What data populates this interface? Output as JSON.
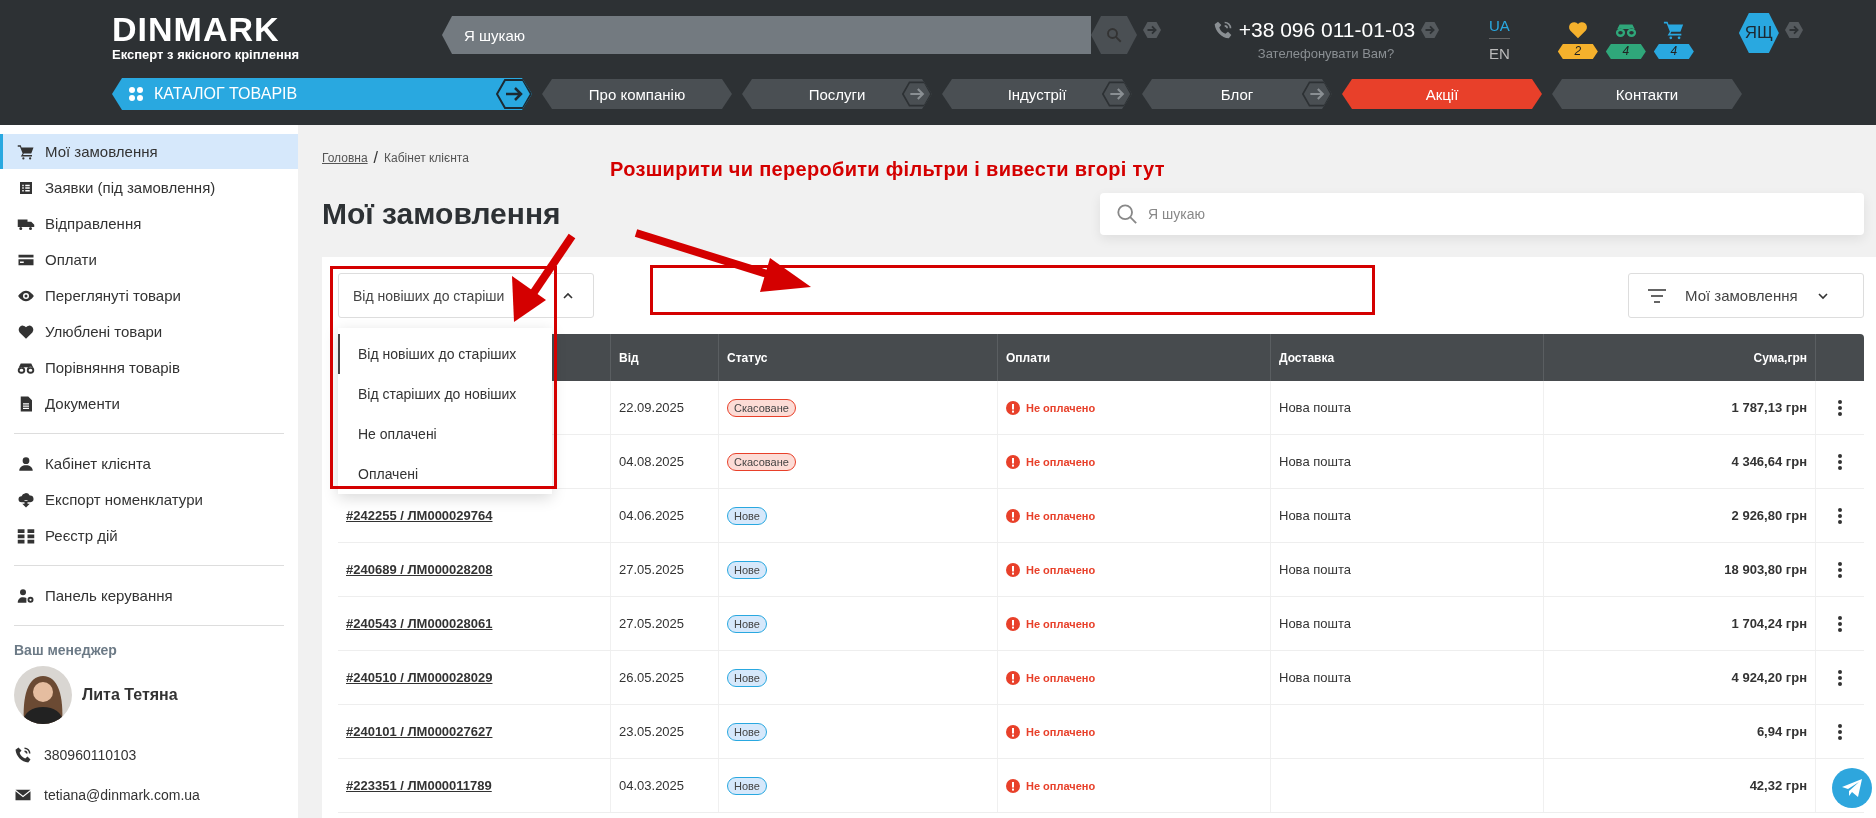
{
  "header": {
    "logo": "DINMARK",
    "tagline": "Експерт з якісного кріплення",
    "search": {
      "placeholder": "Я шукаю"
    },
    "phone": "+38 096 011-01-03",
    "callback": "Зателефонувати Вам?",
    "languages": [
      {
        "label": "UA",
        "selected": true
      },
      {
        "label": "EN",
        "selected": false
      }
    ],
    "counters": [
      {
        "count": "2",
        "color": "#f5b12c"
      },
      {
        "count": "4",
        "color": "#2fa77a"
      },
      {
        "count": "4",
        "color": "#29a8e0"
      }
    ],
    "user": "ЯЩ",
    "nav": [
      {
        "label": "КАТАЛОГ ТОВАРІВ",
        "kind": "catalog",
        "arrow": true
      },
      {
        "label": "Про компанію",
        "kind": "link",
        "arrow": false
      },
      {
        "label": "Послуги",
        "kind": "link",
        "arrow": true
      },
      {
        "label": "Індустрії",
        "kind": "link",
        "arrow": true
      },
      {
        "label": "Блог",
        "kind": "link",
        "arrow": true
      },
      {
        "label": "Акції",
        "kind": "promo",
        "arrow": false
      },
      {
        "label": "Контакти",
        "kind": "link",
        "arrow": false
      }
    ]
  },
  "sidebar": {
    "groups": [
      {
        "items": [
          {
            "label": "Мої замовлення",
            "selected": true
          },
          {
            "label": "Заявки (під замовлення)",
            "selected": false
          },
          {
            "label": "Відправлення",
            "selected": false
          },
          {
            "label": "Оплати",
            "selected": false
          },
          {
            "label": "Переглянуті товари",
            "selected": false
          },
          {
            "label": "Улюблені товари",
            "selected": false
          },
          {
            "label": "Порівняння товарів",
            "selected": false
          },
          {
            "label": "Документи",
            "selected": false
          }
        ]
      },
      {
        "items": [
          {
            "label": "Кабінет клієнта",
            "selected": false
          },
          {
            "label": "Експорт номенклатури",
            "selected": false
          },
          {
            "label": "Реєстр дій",
            "selected": false
          }
        ]
      },
      {
        "items": [
          {
            "label": "Панель керування",
            "selected": false
          }
        ]
      }
    ],
    "manager": {
      "heading": "Ваш менеджер",
      "name": "Лита Тетяна",
      "phone": "380960110103",
      "email": "tetiana@dinmark.com.ua"
    }
  },
  "breadcrumb": {
    "link": "Головна",
    "separator": "/",
    "current": "Кабінет клієнта"
  },
  "title": "Мої замовлення",
  "search": {
    "placeholder": "Я шукаю"
  },
  "annotation": "Розширити чи переробити фільтри і вивести вгорі тут",
  "sort": {
    "value": "Від новіших до старіши",
    "expanded": true,
    "options": [
      {
        "label": "Від новіших до старіших",
        "selected": true
      },
      {
        "label": "Від старіших до новіших",
        "selected": false
      },
      {
        "label": "Не оплачені",
        "selected": false
      },
      {
        "label": "Оплачені",
        "selected": false
      }
    ]
  },
  "view_button": "Мої замовлення",
  "table": {
    "columns": [
      "Від",
      "Статус",
      "Оплати",
      "Доставка",
      "Сума,грн"
    ],
    "rows": [
      {
        "date": "22.09.2025",
        "status": {
          "label": "Скасоване",
          "kind": "cancelled"
        },
        "payment": "Не оплачено",
        "delivery": "Нова пошта",
        "sum": "1 787,13 грн"
      },
      {
        "date": "04.08.2025",
        "status": {
          "label": "Скасоване",
          "kind": "cancelled"
        },
        "payment": "Не оплачено",
        "delivery": "Нова пошта",
        "sum": "4 346,64 грн"
      },
      {
        "order": "#242255 / ЛМ000029764",
        "date": "04.06.2025",
        "status": {
          "label": "Нове",
          "kind": "new"
        },
        "payment": "Не оплачено",
        "delivery": "Нова пошта",
        "sum": "2 926,80 грн"
      },
      {
        "order": "#240689 / ЛМ000028208",
        "date": "27.05.2025",
        "status": {
          "label": "Нове",
          "kind": "new"
        },
        "payment": "Не оплачено",
        "delivery": "Нова пошта",
        "sum": "18 903,80 грн"
      },
      {
        "order": "#240543 / ЛМ000028061",
        "date": "27.05.2025",
        "status": {
          "label": "Нове",
          "kind": "new"
        },
        "payment": "Не оплачено",
        "delivery": "Нова пошта",
        "sum": "1 704,24 грн"
      },
      {
        "order": "#240510 / ЛМ000028029",
        "date": "26.05.2025",
        "status": {
          "label": "Нове",
          "kind": "new"
        },
        "payment": "Не оплачено",
        "delivery": "Нова пошта",
        "sum": "4 924,20 грн"
      },
      {
        "order": "#240101 / ЛМ000027627",
        "date": "23.05.2025",
        "status": {
          "label": "Нове",
          "kind": "new"
        },
        "payment": "Не оплачено",
        "sum": "6,94 грн"
      },
      {
        "order": "#223351 / ЛМ000011789",
        "date": "04.03.2025",
        "status": {
          "label": "Нове",
          "kind": "new"
        },
        "payment": "Не оплачено",
        "sum": "42,32 грн"
      }
    ]
  }
}
